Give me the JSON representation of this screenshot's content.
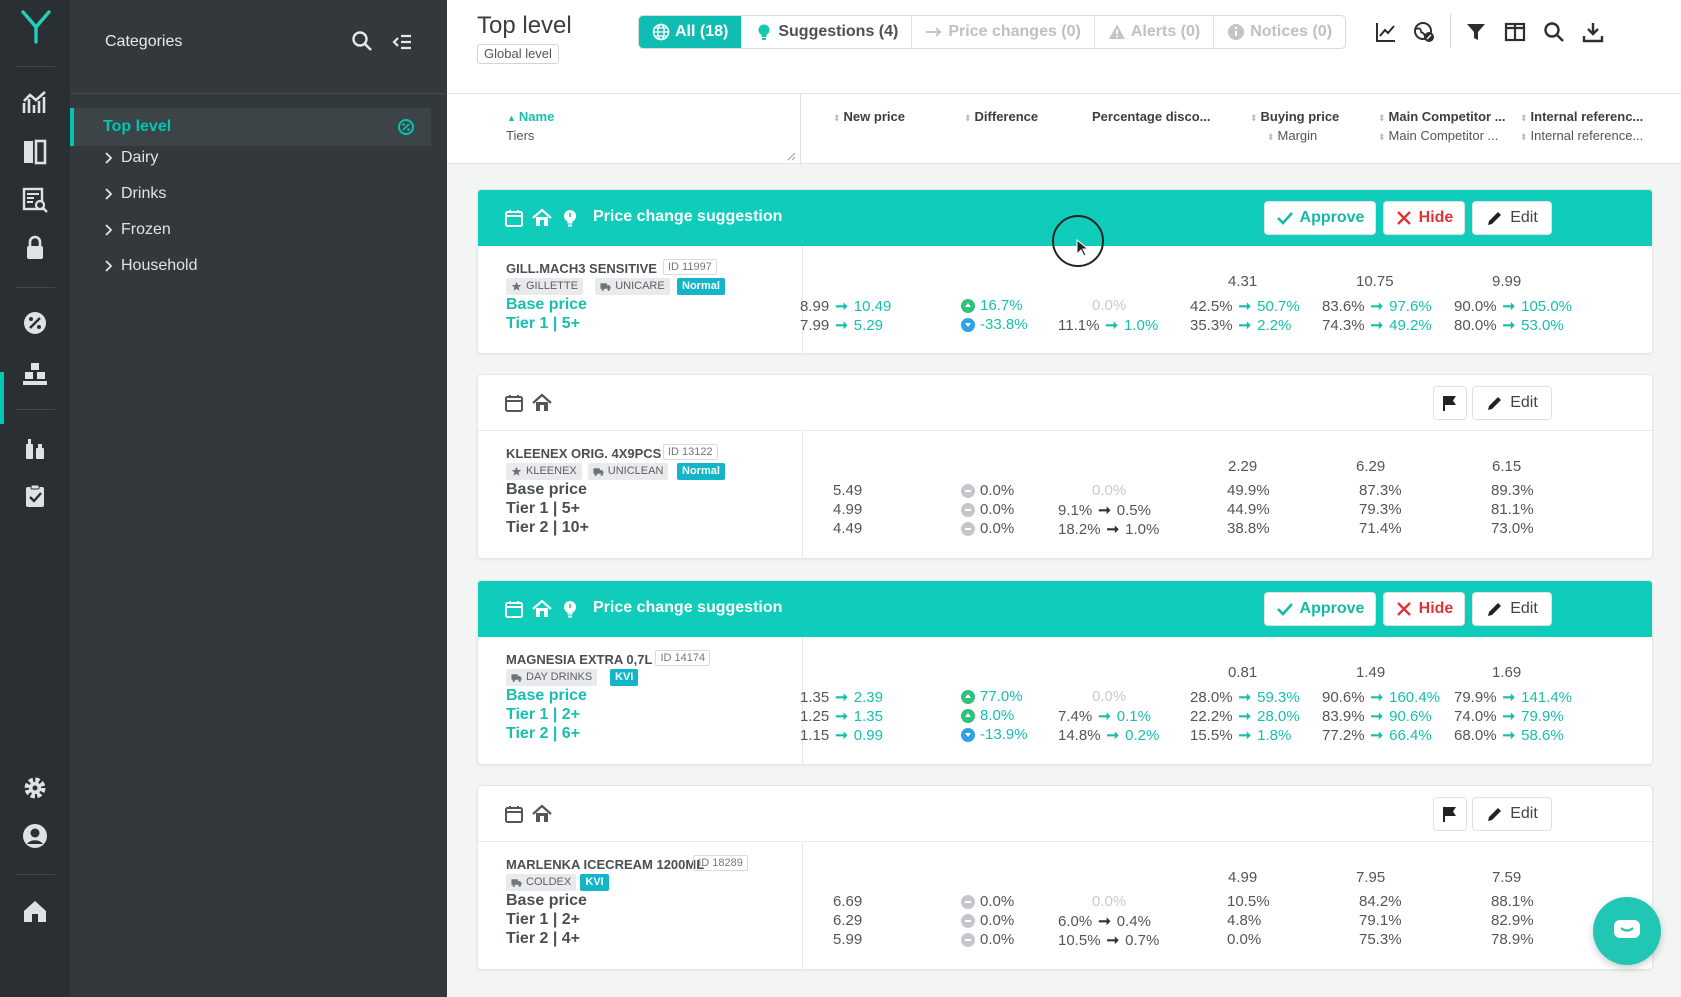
{
  "categories": {
    "title": "Categories",
    "active": "Top level",
    "items": [
      "Dairy",
      "Drinks",
      "Frozen",
      "Household"
    ]
  },
  "header": {
    "title": "Top level",
    "level": "Global level"
  },
  "filters": [
    {
      "label": "All (18)",
      "icon": "globe-icon",
      "state": "active"
    },
    {
      "label": "Suggestions (4)",
      "icon": "lightbulb-icon",
      "state": "normal"
    },
    {
      "label": "Price changes (0)",
      "icon": "arrow-right-icon",
      "state": "disabled"
    },
    {
      "label": "Alerts (0)",
      "icon": "warning-icon",
      "state": "disabled"
    },
    {
      "label": "Notices (0)",
      "icon": "info-icon",
      "state": "disabled"
    }
  ],
  "columns": {
    "name": "Name",
    "name_sub": "Tiers",
    "new_price": "New price",
    "difference": "Difference",
    "pct_discount": "Percentage disco...",
    "buying_price": "Buying price",
    "buying_sub": "Margin",
    "main_comp": "Main Competitor ...",
    "main_comp_sub": "Main Competitor ...",
    "internal_ref": "Internal referenc...",
    "internal_ref_sub": "Internal reference..."
  },
  "buttons": {
    "approve": "Approve",
    "hide": "Hide",
    "edit": "Edit"
  },
  "suggestion_title": "Price change suggestion",
  "products": [
    {
      "name": "GILL.MACH3 SENSITIVE",
      "id": "ID 11997",
      "tags": [
        {
          "t": "GILLETTE",
          "icon": "star-icon"
        },
        {
          "t": "UNICARE",
          "icon": "truck-icon"
        }
      ],
      "badge": "Normal",
      "buying": "4.31",
      "comp": "10.75",
      "ref": "9.99",
      "rows": [
        {
          "label": "Base price",
          "old": "8.99",
          "new": "10.49",
          "dir": "up",
          "diff": "16.7%",
          "disc": "0.0%",
          "disc_muted": true,
          "bold": "",
          "m1": "42.5%",
          "m1n": "50.7%",
          "c1": "83.6%",
          "c1n": "97.6%",
          "r1": "90.0%",
          "r1n": "105.0%"
        },
        {
          "label": "Tier 1 | 5+",
          "old": "7.99",
          "new": "5.29",
          "dir": "down",
          "diff": "-33.8%",
          "disc": "11.1%",
          "discn": "1.0%",
          "m1": "35.3%",
          "m1n": "2.2%",
          "c1": "74.3%",
          "c1n": "49.2%",
          "r1": "80.0%",
          "r1n": "53.0%"
        }
      ]
    },
    {
      "name": "KLEENEX ORIG. 4X9PCS",
      "id": "ID 13122",
      "tags": [
        {
          "t": "KLEENEX",
          "icon": "star-icon"
        },
        {
          "t": "UNICLEAN",
          "icon": "truck-icon"
        }
      ],
      "badge": "Normal",
      "buying": "2.29",
      "comp": "6.29",
      "ref": "6.15",
      "rows": [
        {
          "label": "Base price",
          "val": "5.49",
          "diff": "0.0%",
          "disc": "0.0%",
          "disc_muted": true,
          "m1": "49.9%",
          "c1": "87.3%",
          "r1": "89.3%"
        },
        {
          "label": "Tier 1 | 5+",
          "val": "4.99",
          "diff": "0.0%",
          "disc": "9.1%",
          "discn": "0.5%",
          "m1": "44.9%",
          "c1": "79.3%",
          "r1": "81.1%"
        },
        {
          "label": "Tier 2 | 10+",
          "val": "4.49",
          "diff": "0.0%",
          "disc": "18.2%",
          "discn": "1.0%",
          "m1": "38.8%",
          "c1": "71.4%",
          "r1": "73.0%"
        }
      ]
    },
    {
      "name": "MAGNESIA EXTRA 0,7L",
      "id": "ID 14174",
      "tags": [
        {
          "t": "DAY DRINKS",
          "icon": "truck-icon"
        }
      ],
      "badge": "KVI",
      "buying": "0.81",
      "comp": "1.49",
      "ref": "1.69",
      "rows": [
        {
          "label": "Base price",
          "old": "1.35",
          "new": "2.39",
          "dir": "up",
          "diff": "77.0%",
          "disc": "0.0%",
          "disc_muted": true,
          "m1": "28.0%",
          "m1n": "59.3%",
          "c1": "90.6%",
          "c1n": "160.4%",
          "r1": "79.9%",
          "r1n": "141.4%"
        },
        {
          "label": "Tier 1 | 2+",
          "old": "1.25",
          "new": "1.35",
          "dir": "up",
          "diff": "8.0%",
          "disc": "7.4%",
          "discn": "0.1%",
          "m1": "22.2%",
          "m1n": "28.0%",
          "c1": "83.9%",
          "c1n": "90.6%",
          "r1": "74.0%",
          "r1n": "79.9%"
        },
        {
          "label": "Tier 2 | 6+",
          "old": "1.15",
          "new": "0.99",
          "dir": "down",
          "diff": "-13.9%",
          "disc": "14.8%",
          "discn": "0.2%",
          "m1": "15.5%",
          "m1n": "1.8%",
          "c1": "77.2%",
          "c1n": "66.4%",
          "r1": "68.0%",
          "r1n": "58.6%"
        }
      ]
    },
    {
      "name": "MARLENKA ICECREAM 1200ML",
      "id": "ID 18289",
      "tags": [
        {
          "t": "COLDEX",
          "icon": "truck-icon"
        }
      ],
      "badge": "KVI",
      "buying": "4.99",
      "comp": "7.95",
      "ref": "7.59",
      "rows": [
        {
          "label": "Base price",
          "val": "6.69",
          "diff": "0.0%",
          "disc": "0.0%",
          "disc_muted": true,
          "m1": "10.5%",
          "c1": "84.2%",
          "r1": "88.1%"
        },
        {
          "label": "Tier 1 | 2+",
          "val": "6.29",
          "diff": "0.0%",
          "disc": "6.0%",
          "discn": "0.4%",
          "m1": "4.8%",
          "c1": "79.1%",
          "r1": "82.9%"
        },
        {
          "label": "Tier 2 | 4+",
          "val": "5.99",
          "diff": "0.0%",
          "disc": "10.5%",
          "discn": "0.7%",
          "m1": "0.0%",
          "c1": "75.3%",
          "r1": "78.9%"
        }
      ]
    }
  ],
  "colors": {
    "accent": "#10cdbb",
    "rail": "#2a2f33",
    "sidebar": "#32383c",
    "hide": "#e0343a",
    "up": "#2fc27a",
    "down": "#2da2e6"
  }
}
